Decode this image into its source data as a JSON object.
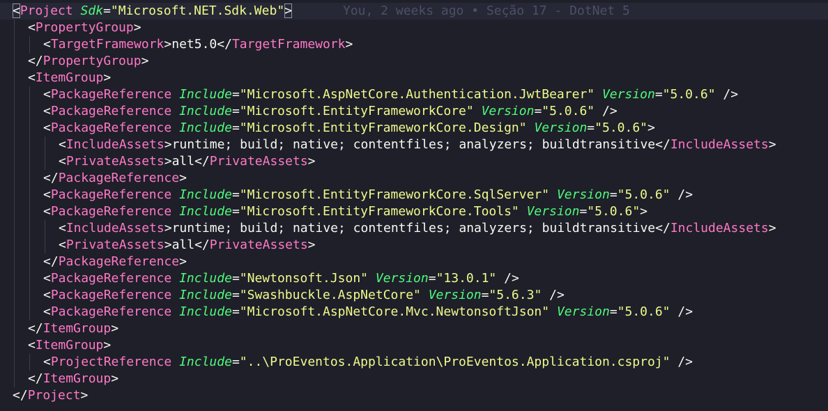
{
  "editor": {
    "blame_text": "You, 2 weeks ago • Seção 17 - DotNet 5",
    "colors": {
      "background": "#1e1f29",
      "tag": "#ff79c6",
      "attribute": "#50fa7b",
      "string": "#f1fa8c",
      "text": "#f8f8f2",
      "blame": "#4d5066"
    },
    "lines": [
      {
        "indent": 0,
        "current": true,
        "tokens": [
          {
            "t": "p",
            "v": "<"
          },
          {
            "t": "tag",
            "v": "Project"
          },
          {
            "t": "txt",
            "v": " "
          },
          {
            "t": "attr",
            "v": "Sdk"
          },
          {
            "t": "p",
            "v": "="
          },
          {
            "t": "str",
            "v": "\"Microsoft.NET.Sdk.Web\""
          },
          {
            "t": "p",
            "v": ">"
          }
        ]
      },
      {
        "indent": 1,
        "tokens": [
          {
            "t": "p",
            "v": "<"
          },
          {
            "t": "tag",
            "v": "PropertyGroup"
          },
          {
            "t": "p",
            "v": ">"
          }
        ]
      },
      {
        "indent": 2,
        "tokens": [
          {
            "t": "p",
            "v": "<"
          },
          {
            "t": "tag",
            "v": "TargetFramework"
          },
          {
            "t": "p",
            "v": ">"
          },
          {
            "t": "txt",
            "v": "net5.0"
          },
          {
            "t": "p",
            "v": "</"
          },
          {
            "t": "tag",
            "v": "TargetFramework"
          },
          {
            "t": "p",
            "v": ">"
          }
        ]
      },
      {
        "indent": 1,
        "tokens": [
          {
            "t": "p",
            "v": "</"
          },
          {
            "t": "tag",
            "v": "PropertyGroup"
          },
          {
            "t": "p",
            "v": ">"
          }
        ]
      },
      {
        "indent": 1,
        "tokens": [
          {
            "t": "p",
            "v": "<"
          },
          {
            "t": "tag",
            "v": "ItemGroup"
          },
          {
            "t": "p",
            "v": ">"
          }
        ]
      },
      {
        "indent": 2,
        "tokens": [
          {
            "t": "p",
            "v": "<"
          },
          {
            "t": "tag",
            "v": "PackageReference"
          },
          {
            "t": "txt",
            "v": " "
          },
          {
            "t": "attr",
            "v": "Include"
          },
          {
            "t": "p",
            "v": "="
          },
          {
            "t": "str",
            "v": "\"Microsoft.AspNetCore.Authentication.JwtBearer\""
          },
          {
            "t": "txt",
            "v": " "
          },
          {
            "t": "attr",
            "v": "Version"
          },
          {
            "t": "p",
            "v": "="
          },
          {
            "t": "str",
            "v": "\"5.0.6\""
          },
          {
            "t": "txt",
            "v": " "
          },
          {
            "t": "p",
            "v": "/>"
          }
        ]
      },
      {
        "indent": 2,
        "tokens": [
          {
            "t": "p",
            "v": "<"
          },
          {
            "t": "tag",
            "v": "PackageReference"
          },
          {
            "t": "txt",
            "v": " "
          },
          {
            "t": "attr",
            "v": "Include"
          },
          {
            "t": "p",
            "v": "="
          },
          {
            "t": "str",
            "v": "\"Microsoft.EntityFrameworkCore\""
          },
          {
            "t": "txt",
            "v": " "
          },
          {
            "t": "attr",
            "v": "Version"
          },
          {
            "t": "p",
            "v": "="
          },
          {
            "t": "str",
            "v": "\"5.0.6\""
          },
          {
            "t": "txt",
            "v": " "
          },
          {
            "t": "p",
            "v": "/>"
          }
        ]
      },
      {
        "indent": 2,
        "tokens": [
          {
            "t": "p",
            "v": "<"
          },
          {
            "t": "tag",
            "v": "PackageReference"
          },
          {
            "t": "txt",
            "v": " "
          },
          {
            "t": "attr",
            "v": "Include"
          },
          {
            "t": "p",
            "v": "="
          },
          {
            "t": "str",
            "v": "\"Microsoft.EntityFrameworkCore.Design\""
          },
          {
            "t": "txt",
            "v": " "
          },
          {
            "t": "attr",
            "v": "Version"
          },
          {
            "t": "p",
            "v": "="
          },
          {
            "t": "str",
            "v": "\"5.0.6\""
          },
          {
            "t": "p",
            "v": ">"
          }
        ]
      },
      {
        "indent": 3,
        "tokens": [
          {
            "t": "p",
            "v": "<"
          },
          {
            "t": "tag",
            "v": "IncludeAssets"
          },
          {
            "t": "p",
            "v": ">"
          },
          {
            "t": "txt",
            "v": "runtime; build; native; contentfiles; analyzers; buildtransitive"
          },
          {
            "t": "p",
            "v": "</"
          },
          {
            "t": "tag",
            "v": "IncludeAssets"
          },
          {
            "t": "p",
            "v": ">"
          }
        ]
      },
      {
        "indent": 3,
        "tokens": [
          {
            "t": "p",
            "v": "<"
          },
          {
            "t": "tag",
            "v": "PrivateAssets"
          },
          {
            "t": "p",
            "v": ">"
          },
          {
            "t": "txt",
            "v": "all"
          },
          {
            "t": "p",
            "v": "</"
          },
          {
            "t": "tag",
            "v": "PrivateAssets"
          },
          {
            "t": "p",
            "v": ">"
          }
        ]
      },
      {
        "indent": 2,
        "tokens": [
          {
            "t": "p",
            "v": "</"
          },
          {
            "t": "tag",
            "v": "PackageReference"
          },
          {
            "t": "p",
            "v": ">"
          }
        ]
      },
      {
        "indent": 2,
        "tokens": [
          {
            "t": "p",
            "v": "<"
          },
          {
            "t": "tag",
            "v": "PackageReference"
          },
          {
            "t": "txt",
            "v": " "
          },
          {
            "t": "attr",
            "v": "Include"
          },
          {
            "t": "p",
            "v": "="
          },
          {
            "t": "str",
            "v": "\"Microsoft.EntityFrameworkCore.SqlServer\""
          },
          {
            "t": "txt",
            "v": " "
          },
          {
            "t": "attr",
            "v": "Version"
          },
          {
            "t": "p",
            "v": "="
          },
          {
            "t": "str",
            "v": "\"5.0.6\""
          },
          {
            "t": "txt",
            "v": " "
          },
          {
            "t": "p",
            "v": "/>"
          }
        ]
      },
      {
        "indent": 2,
        "tokens": [
          {
            "t": "p",
            "v": "<"
          },
          {
            "t": "tag",
            "v": "PackageReference"
          },
          {
            "t": "txt",
            "v": " "
          },
          {
            "t": "attr",
            "v": "Include"
          },
          {
            "t": "p",
            "v": "="
          },
          {
            "t": "str",
            "v": "\"Microsoft.EntityFrameworkCore.Tools\""
          },
          {
            "t": "txt",
            "v": " "
          },
          {
            "t": "attr",
            "v": "Version"
          },
          {
            "t": "p",
            "v": "="
          },
          {
            "t": "str",
            "v": "\"5.0.6\""
          },
          {
            "t": "p",
            "v": ">"
          }
        ]
      },
      {
        "indent": 3,
        "tokens": [
          {
            "t": "p",
            "v": "<"
          },
          {
            "t": "tag",
            "v": "IncludeAssets"
          },
          {
            "t": "p",
            "v": ">"
          },
          {
            "t": "txt",
            "v": "runtime; build; native; contentfiles; analyzers; buildtransitive"
          },
          {
            "t": "p",
            "v": "</"
          },
          {
            "t": "tag",
            "v": "IncludeAssets"
          },
          {
            "t": "p",
            "v": ">"
          }
        ]
      },
      {
        "indent": 3,
        "tokens": [
          {
            "t": "p",
            "v": "<"
          },
          {
            "t": "tag",
            "v": "PrivateAssets"
          },
          {
            "t": "p",
            "v": ">"
          },
          {
            "t": "txt",
            "v": "all"
          },
          {
            "t": "p",
            "v": "</"
          },
          {
            "t": "tag",
            "v": "PrivateAssets"
          },
          {
            "t": "p",
            "v": ">"
          }
        ]
      },
      {
        "indent": 2,
        "tokens": [
          {
            "t": "p",
            "v": "</"
          },
          {
            "t": "tag",
            "v": "PackageReference"
          },
          {
            "t": "p",
            "v": ">"
          }
        ]
      },
      {
        "indent": 2,
        "tokens": [
          {
            "t": "p",
            "v": "<"
          },
          {
            "t": "tag",
            "v": "PackageReference"
          },
          {
            "t": "txt",
            "v": " "
          },
          {
            "t": "attr",
            "v": "Include"
          },
          {
            "t": "p",
            "v": "="
          },
          {
            "t": "str",
            "v": "\"Newtonsoft.Json\""
          },
          {
            "t": "txt",
            "v": " "
          },
          {
            "t": "attr",
            "v": "Version"
          },
          {
            "t": "p",
            "v": "="
          },
          {
            "t": "str",
            "v": "\"13.0.1\""
          },
          {
            "t": "txt",
            "v": " "
          },
          {
            "t": "p",
            "v": "/>"
          }
        ]
      },
      {
        "indent": 2,
        "tokens": [
          {
            "t": "p",
            "v": "<"
          },
          {
            "t": "tag",
            "v": "PackageReference"
          },
          {
            "t": "txt",
            "v": " "
          },
          {
            "t": "attr",
            "v": "Include"
          },
          {
            "t": "p",
            "v": "="
          },
          {
            "t": "str",
            "v": "\"Swashbuckle.AspNetCore\""
          },
          {
            "t": "txt",
            "v": " "
          },
          {
            "t": "attr",
            "v": "Version"
          },
          {
            "t": "p",
            "v": "="
          },
          {
            "t": "str",
            "v": "\"5.6.3\""
          },
          {
            "t": "txt",
            "v": " "
          },
          {
            "t": "p",
            "v": "/>"
          }
        ]
      },
      {
        "indent": 2,
        "tokens": [
          {
            "t": "p",
            "v": "<"
          },
          {
            "t": "tag",
            "v": "PackageReference"
          },
          {
            "t": "txt",
            "v": " "
          },
          {
            "t": "attr",
            "v": "Include"
          },
          {
            "t": "p",
            "v": "="
          },
          {
            "t": "str",
            "v": "\"Microsoft.AspNetCore.Mvc.NewtonsoftJson\""
          },
          {
            "t": "txt",
            "v": " "
          },
          {
            "t": "attr",
            "v": "Version"
          },
          {
            "t": "p",
            "v": "="
          },
          {
            "t": "str",
            "v": "\"5.0.6\""
          },
          {
            "t": "txt",
            "v": " "
          },
          {
            "t": "p",
            "v": "/>"
          }
        ]
      },
      {
        "indent": 1,
        "tokens": [
          {
            "t": "p",
            "v": "</"
          },
          {
            "t": "tag",
            "v": "ItemGroup"
          },
          {
            "t": "p",
            "v": ">"
          }
        ]
      },
      {
        "indent": 1,
        "tokens": [
          {
            "t": "p",
            "v": "<"
          },
          {
            "t": "tag",
            "v": "ItemGroup"
          },
          {
            "t": "p",
            "v": ">"
          }
        ]
      },
      {
        "indent": 2,
        "tokens": [
          {
            "t": "p",
            "v": "<"
          },
          {
            "t": "tag",
            "v": "ProjectReference"
          },
          {
            "t": "txt",
            "v": " "
          },
          {
            "t": "attr",
            "v": "Include"
          },
          {
            "t": "p",
            "v": "="
          },
          {
            "t": "str",
            "v": "\"..\\ProEventos.Application\\ProEventos.Application.csproj\""
          },
          {
            "t": "txt",
            "v": " "
          },
          {
            "t": "p",
            "v": "/>"
          }
        ]
      },
      {
        "indent": 1,
        "tokens": [
          {
            "t": "p",
            "v": "</"
          },
          {
            "t": "tag",
            "v": "ItemGroup"
          },
          {
            "t": "p",
            "v": ">"
          }
        ]
      },
      {
        "indent": 0,
        "tokens": [
          {
            "t": "p",
            "v": "</"
          },
          {
            "t": "tag",
            "v": "Project"
          },
          {
            "t": "p",
            "v": ">"
          }
        ]
      }
    ]
  }
}
